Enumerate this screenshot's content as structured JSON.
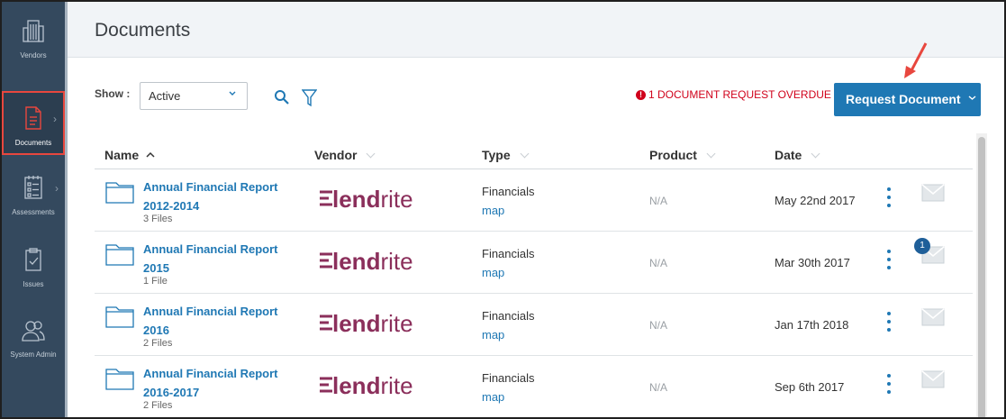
{
  "sidebar": {
    "items": [
      {
        "label": "Vendors",
        "icon": "building-icon"
      },
      {
        "label": "Documents",
        "icon": "document-icon"
      },
      {
        "label": "Assessments",
        "icon": "checklist-icon"
      },
      {
        "label": "Issues",
        "icon": "clipboard-icon"
      },
      {
        "label": "System Admin",
        "icon": "users-icon"
      }
    ]
  },
  "header": {
    "title": "Documents"
  },
  "toolbar": {
    "show_label": "Show :",
    "show_value": "Active",
    "overdue_text": "1 DOCUMENT REQUEST OVERDUE",
    "request_label": "Request Document"
  },
  "table": {
    "columns": [
      "Name",
      "Vendor",
      "Type",
      "Product",
      "Date"
    ],
    "rows": [
      {
        "name": "Annual Financial Report 2012-2014",
        "files": "3 Files",
        "vendor": "lendrite",
        "type": "Financials",
        "link": "map",
        "product": "N/A",
        "date": "May 22nd 2017",
        "badge": ""
      },
      {
        "name": "Annual Financial Report 2015",
        "files": "1 File",
        "vendor": "lendrite",
        "type": "Financials",
        "link": "map",
        "product": "N/A",
        "date": "Mar 30th 2017",
        "badge": "1"
      },
      {
        "name": "Annual Financial Report 2016",
        "files": "2 Files",
        "vendor": "lendrite",
        "type": "Financials",
        "link": "map",
        "product": "N/A",
        "date": "Jan 17th 2018",
        "badge": ""
      },
      {
        "name": "Annual Financial Report 2016-2017",
        "files": "2 Files",
        "vendor": "lendrite",
        "type": "Financials",
        "link": "map",
        "product": "N/A",
        "date": "Sep 6th 2017",
        "badge": ""
      }
    ]
  },
  "colors": {
    "sidebar": "#34495e",
    "accent": "#1f78b4",
    "overdue": "#d0021b",
    "highlight": "#e8473e",
    "vendor_logo": "#8b2f5b"
  }
}
